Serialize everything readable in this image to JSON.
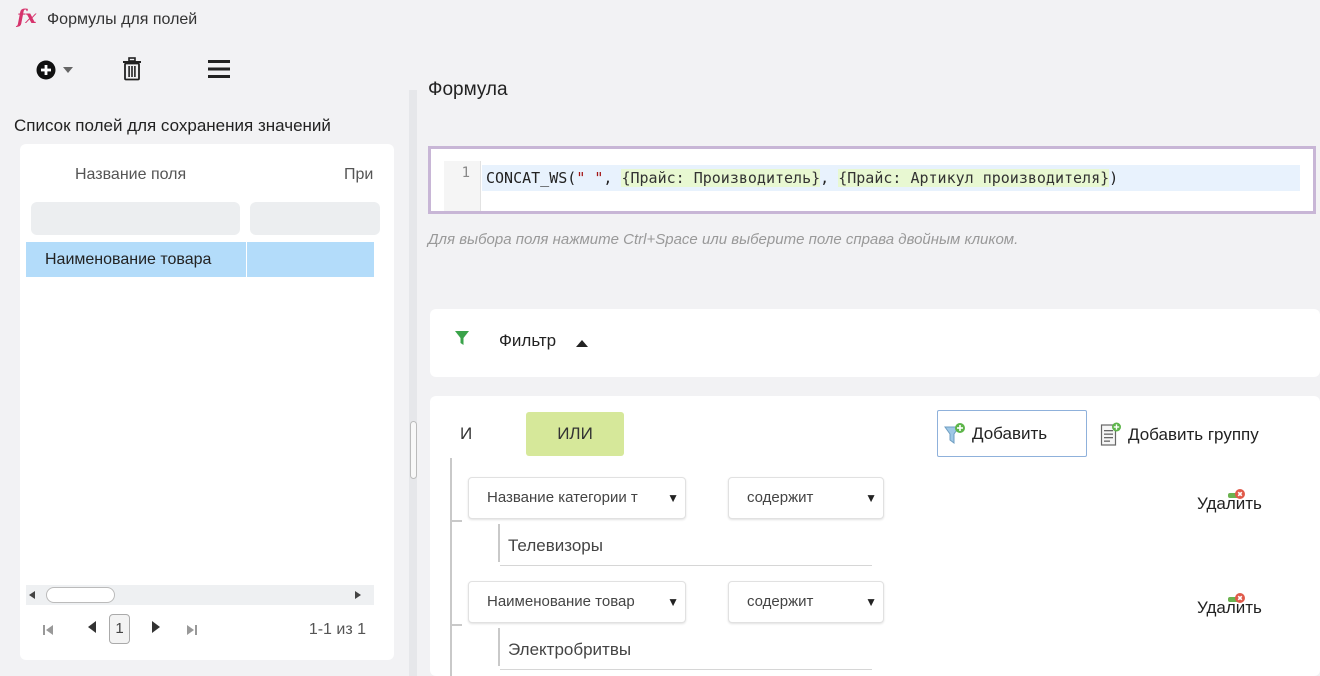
{
  "window": {
    "logo": "fx",
    "title": "Формулы для полей"
  },
  "left": {
    "heading": "Список полей для сохранения значений",
    "columns": [
      "Название поля",
      "При"
    ],
    "rows": [
      {
        "name": "Наименование товара",
        "extra": ""
      }
    ],
    "pager": {
      "page": "1",
      "info": "1-1 из 1"
    }
  },
  "formula": {
    "title": "Формула",
    "line_number": "1",
    "code": {
      "func": "CONCAT_WS(",
      "str": "\" \"",
      "sep1": ", ",
      "field1": "{Прайс: Производитель}",
      "sep2": ", ",
      "field2": "{Прайс: Артикул производителя}",
      "close": ")"
    },
    "hint": "Для выбора поля нажмите Ctrl+Space или выберите поле справа двойным кликом."
  },
  "filter": {
    "label": "Фильтр",
    "and_label": "И",
    "or_label": "ИЛИ",
    "add_label": "Добавить",
    "add_group_label": "Добавить группу",
    "conditions": [
      {
        "field": "Название категории т",
        "operator": "содержит",
        "value": "Телевизоры",
        "delete_label": "Удалить"
      },
      {
        "field": "Наименование товар",
        "operator": "содержит",
        "value": "Электробритвы",
        "delete_label": "Удалить"
      }
    ]
  },
  "colors": {
    "accent_pink": "#d6336c",
    "or_active": "#d6e89a",
    "row_selected": "#b3dcfa",
    "filter_green": "#3aa34a"
  }
}
